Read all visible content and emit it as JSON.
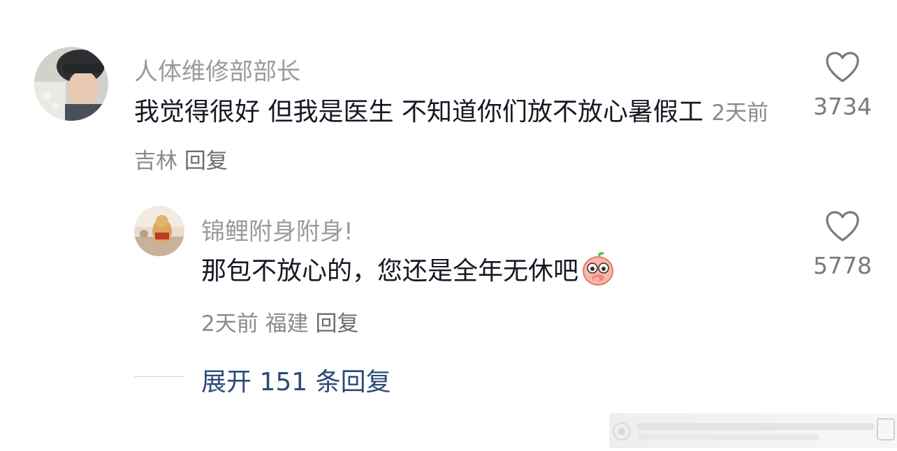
{
  "comments": [
    {
      "username": "人体维修部部长",
      "text": "我觉得很好  但我是医生  不知道你们放不放心暑假工",
      "meta": {
        "time": "2天前",
        "location": "吉林",
        "reply": "回复"
      },
      "likes": "3734"
    }
  ],
  "sub_comment": {
    "username": "锦鲤附身附身!",
    "text": "那包不放心的，您还是全年无休吧",
    "emoji": "peach-emoji",
    "meta": {
      "time": "2天前",
      "location": "福建",
      "reply": "回复"
    },
    "likes": "5778"
  },
  "expand": {
    "label": "展开 151 条回复"
  },
  "icons": {
    "like": "heart-outline-icon"
  },
  "colors": {
    "link": "#2c4a7a",
    "meta": "#8a8a8e",
    "text": "#161823"
  }
}
